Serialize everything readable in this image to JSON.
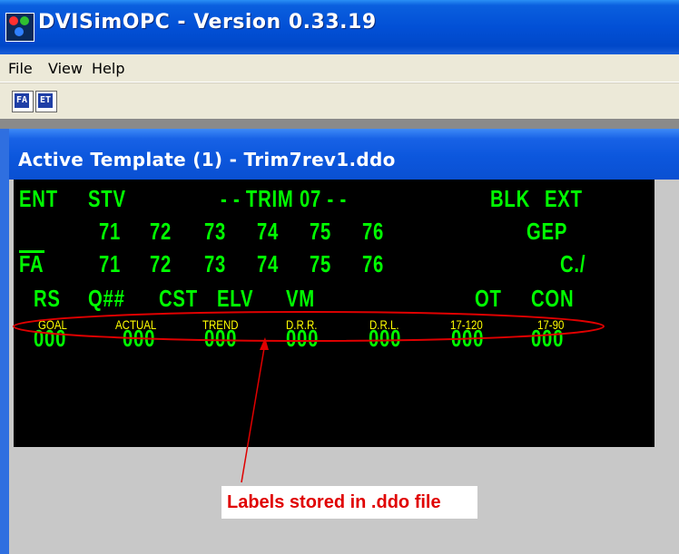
{
  "window": {
    "title": "DVISimOPC - Version 0.33.19",
    "icon": "app-logo-icon"
  },
  "menu": {
    "file": "File",
    "view": "View",
    "help": "Help"
  },
  "toolbar": {
    "buttons": [
      {
        "icon": "template-fa-icon",
        "glyph": "FA"
      },
      {
        "icon": "template-et-icon",
        "glyph": "ET"
      }
    ]
  },
  "child_window": {
    "title": "Active Template (1) - Trim7rev1.ddo"
  },
  "display": {
    "row1": {
      "ent": "ENT",
      "stv": "STV",
      "title": "- - TRIM 07 - -",
      "blk": "BLK",
      "ext": "EXT"
    },
    "row2": {
      "n71": "71",
      "n72": "72",
      "n73": "73",
      "n74": "74",
      "n75": "75",
      "n76": "76",
      "gep": "GEP"
    },
    "row3": {
      "fa": "FA",
      "n71": "71",
      "n72": "72",
      "n73": "73",
      "n74": "74",
      "n75": "75",
      "n76": "76",
      "c": "C./"
    },
    "row4": {
      "rs": "RS",
      "q": "Q##",
      "cst": "CST",
      "elv": "ELV",
      "vm": "VM",
      "ot": "OT",
      "con": "CON"
    },
    "labels": [
      "GOAL",
      "ACTUAL",
      "TREND",
      "D.R.R.",
      "D.R.L.",
      "17-120",
      "17-90"
    ],
    "values": [
      "000",
      "000",
      "000",
      "000",
      "000",
      "000",
      "000"
    ],
    "text_color": "#00ff00",
    "label_color": "#ffff00"
  },
  "annotation": {
    "text": "Labels stored in .ddo file",
    "color": "#e00000"
  }
}
